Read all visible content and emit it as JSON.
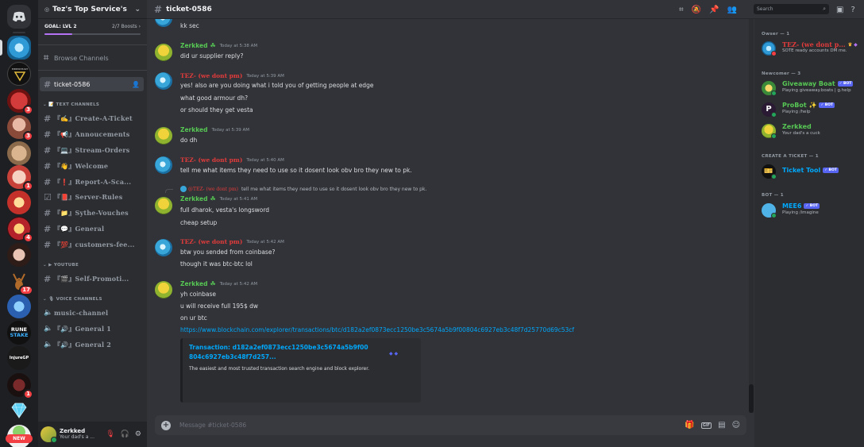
{
  "server": {
    "name": "Tez's Top Service's",
    "goal_label": "GOAL: LVL 2",
    "boosts": "2/7 Boosts",
    "boost_progress": 0.29
  },
  "channels": {
    "browse": "Browse Channels",
    "current": "ticket-0586",
    "text_category": "TEXT CHANNELS",
    "text_items": [
      "『✍』Create-A-Ticket",
      "『📢』Annoucements",
      "『💻』Stream-Orders",
      "『👋』Welcome",
      "『❗』Report-A-Sca...",
      "『📕』Server-Rules",
      "『📁』Sythe-Vouches",
      "『💬』General",
      "『💯』customers-fee..."
    ],
    "youtube_category": "YOUTUBE",
    "youtube_items": [
      "『🎬』Self-Promoti..."
    ],
    "voice_category": "VOICE CHANNELS",
    "voice_items": [
      "music-channel",
      "『🔊』General 1",
      "『🔊』General 2"
    ]
  },
  "rail_badges": [
    "3",
    "3",
    "1",
    "4",
    "17",
    "1"
  ],
  "rail_new": "NEW",
  "user_panel": {
    "name": "Zerkked",
    "status": "Your dad's a ..."
  },
  "header": {
    "channel": "ticket-0586",
    "search_placeholder": "Search"
  },
  "messages": {
    "top_text": "kk sec",
    "m1": {
      "author": "Zerkked",
      "time": "Today at 5:38 AM",
      "lines": [
        "did ur supplier reply?"
      ]
    },
    "m2": {
      "author": "TEZ- (we dont pm)",
      "time": "Today at 5:39 AM",
      "lines": [
        "yes! also are you doing what i told you of getting people at edge",
        "what good armour dh?",
        "or should they get vesta"
      ]
    },
    "m3": {
      "author": "Zerkked",
      "time": "Today at 5:39 AM",
      "lines": [
        "do dh"
      ]
    },
    "m4": {
      "author": "TEZ- (we dont pm)",
      "time": "Today at 5:40 AM",
      "lines": [
        "tell me what items they need to use so it dosent look obv bro they new to pk."
      ]
    },
    "reply": {
      "author": "@TEZ- (we dont pm)",
      "text": "tell me what items they need to use so it dosent look obv bro they new to pk."
    },
    "m5": {
      "author": "Zerkked",
      "time": "Today at 5:41 AM",
      "lines": [
        "full dharok, vesta's longsword",
        "cheap setup"
      ]
    },
    "m6": {
      "author": "TEZ- (we dont pm)",
      "time": "Today at 5:42 AM",
      "lines": [
        "btw you sended from coinbase?",
        "though it was btc-btc lol"
      ]
    },
    "m7": {
      "author": "Zerkked",
      "time": "Today at 5:42 AM",
      "lines": [
        "yh coinbase",
        "u will receive full 195$ dw",
        "on ur btc"
      ],
      "link": "https://www.blockchain.com/explorer/transactions/btc/d182a2ef0873ecc1250be3c5674a5b9f00804c6927eb3c48f7d25770d69c53cf"
    },
    "embed": {
      "title": "Transaction: d182a2ef0873ecc1250be3c5674a5b9f00804c6927eb3c48f7d257...",
      "desc": "The easiest and most trusted transaction search engine and block explorer."
    }
  },
  "input": {
    "placeholder": "Message #ticket-0586"
  },
  "members": {
    "owner_cat": "Owser — 1",
    "owner": {
      "name": "TEZ- (we dont p...",
      "status": "SOTE ready accounts DM me."
    },
    "newcomer_cat": "Newcomer — 3",
    "newcomers": [
      {
        "name": "Giveaway Boat",
        "status": "Playing giveaway.boats | g.help",
        "bot": "✓ BOT"
      },
      {
        "name": "ProBot ✨",
        "status": "Playing /help",
        "bot": "✓ BOT"
      },
      {
        "name": "Zerkked",
        "status": "Your dad's a cuck"
      }
    ],
    "ticket_cat": "CREATE A TICKET — 1",
    "ticket": {
      "name": "Ticket Tool",
      "bot": "✓ BOT"
    },
    "bot_cat": "BOT — 1",
    "bot": {
      "name": "MEE6",
      "status": "Playing /imagine",
      "bot": "✓ BOT"
    }
  },
  "colors": {
    "accent": "#5865f2",
    "tez": "#e23b3b",
    "zerkked": "#57c754",
    "link": "#00a8fc"
  }
}
